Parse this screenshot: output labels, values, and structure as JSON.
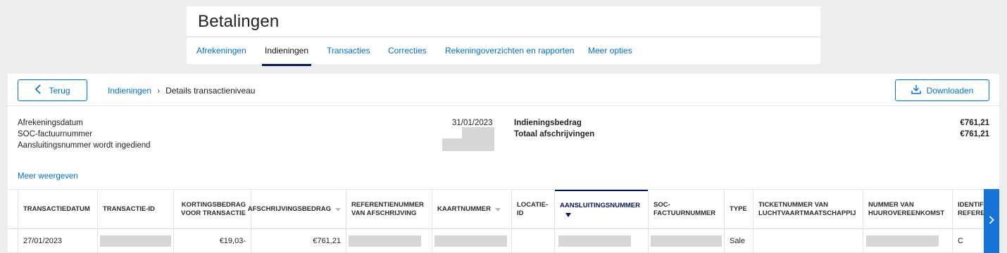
{
  "header": {
    "title": "Betalingen",
    "tabs": [
      {
        "label": "Afrekeningen",
        "active": false
      },
      {
        "label": "Indieningen",
        "active": true
      },
      {
        "label": "Transacties",
        "active": false
      },
      {
        "label": "Correcties",
        "active": false
      },
      {
        "label": "Rekeningoverzichten en rapporten",
        "active": false
      },
      {
        "label": "Meer opties",
        "active": false
      }
    ]
  },
  "toolbar": {
    "back_label": "Terug",
    "breadcrumb": {
      "link": "Indieningen",
      "current": "Details transactieniveau"
    },
    "download_label": "Downloaden"
  },
  "summary": {
    "left_labels": [
      "Afrekeningsdatum",
      "SOC-factuurnummer",
      "Aansluitingsnummer wordt ingediend"
    ],
    "date_value": "31/01/2023",
    "right": [
      {
        "label": "Indieningsbedrag",
        "value": "€761,21"
      },
      {
        "label": "Totaal afschrijvingen",
        "value": "€761,21"
      }
    ],
    "more_link": "Meer weergeven"
  },
  "table": {
    "columns": [
      "Transactiedatum",
      "Transactie-ID",
      "Kortingsbedrag voor transactie",
      "Afschrijvingsbedrag",
      "Referentienummer van afschrijving",
      "Kaartnummer",
      "Locatie-ID",
      "Aansluitingsnummer",
      "SOC-factuurnummer",
      "Type",
      "Ticketnummer van luchtvaartmaatschappij",
      "Nummer van huurovereenkomst",
      "Identif Refere"
    ],
    "active_sort_column": "Aansluitingsnummer",
    "rows": [
      {
        "transactiedatum": "27/01/2023",
        "kortingsbedrag": "€19,03-",
        "afschrijvingsbedrag": "€761,21",
        "type": "Sale",
        "identif": "C"
      }
    ]
  },
  "colors": {
    "link": "#006fcf",
    "active_tab_underline": "#00175a",
    "scroll_button": "#1773d8",
    "redaction": "#d6d6d6"
  }
}
